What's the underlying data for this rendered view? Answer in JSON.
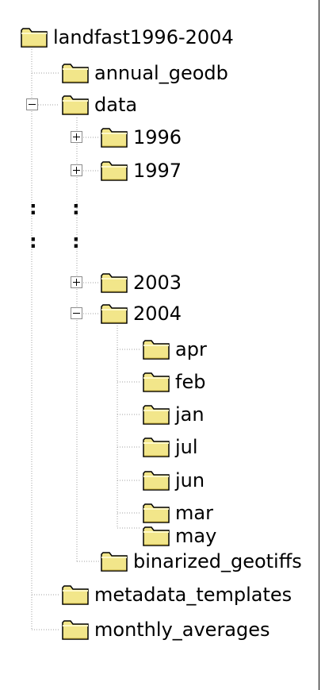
{
  "tree": {
    "root": {
      "label": "landfast1996-2004",
      "icon": "folder-icon"
    },
    "annual_geodb": {
      "label": "annual_geodb",
      "icon": "folder-icon"
    },
    "data": {
      "label": "data",
      "icon": "folder-icon",
      "expanded": true,
      "years": {
        "y1996": {
          "label": "1996",
          "expanded": false
        },
        "y1997": {
          "label": "1997",
          "expanded": false
        },
        "ellipsis_marks": [
          ":",
          ":",
          ":",
          ":"
        ],
        "y2003": {
          "label": "2003",
          "expanded": false
        },
        "y2004": {
          "label": "2004",
          "expanded": true,
          "months": [
            "apr",
            "feb",
            "jan",
            "jul",
            "jun",
            "mar",
            "may"
          ]
        }
      },
      "binarized_geotiffs": {
        "label": "binarized_geotiffs"
      }
    },
    "metadata_templates": {
      "label": "metadata_templates"
    },
    "monthly_averages": {
      "label": "monthly_averages"
    }
  },
  "colors": {
    "folder_fill": "#f2e68a",
    "folder_outline": "#000000",
    "tree_line": "#a0a0a0",
    "toggle_border": "#8c8c8c"
  }
}
